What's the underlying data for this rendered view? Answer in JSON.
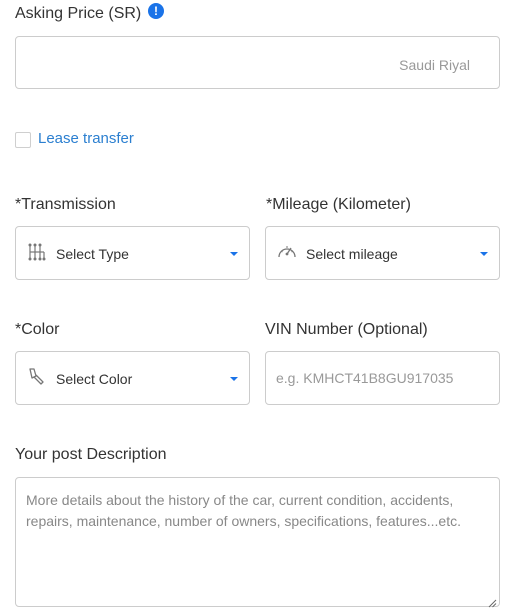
{
  "asking_price": {
    "label": "Asking Price (SR)",
    "info_icon": "info-icon",
    "value": "",
    "currency_suffix": "Saudi Riyal"
  },
  "lease_transfer": {
    "label": "Lease transfer",
    "checked": false
  },
  "transmission": {
    "label": "*Transmission",
    "icon": "gear-shift-icon",
    "selected": "Select Type"
  },
  "mileage": {
    "label": "*Mileage (Kilometer)",
    "icon": "speedometer-icon",
    "selected": "Select mileage"
  },
  "color": {
    "label": "*Color",
    "icon": "paint-brush-icon",
    "selected": "Select Color"
  },
  "vin": {
    "label": "VIN Number (Optional)",
    "value": "",
    "placeholder": "e.g. KMHCT41B8GU917035"
  },
  "description": {
    "label": "Your post Description",
    "value": "",
    "placeholder": "More details about the history of the car, current condition, accidents, repairs, maintenance, number of owners, specifications, features...etc."
  },
  "colors": {
    "accent": "#1a73e8",
    "link": "#2b7fd0",
    "border": "#cccccc",
    "label_text": "#333333",
    "placeholder_text": "#999999"
  }
}
